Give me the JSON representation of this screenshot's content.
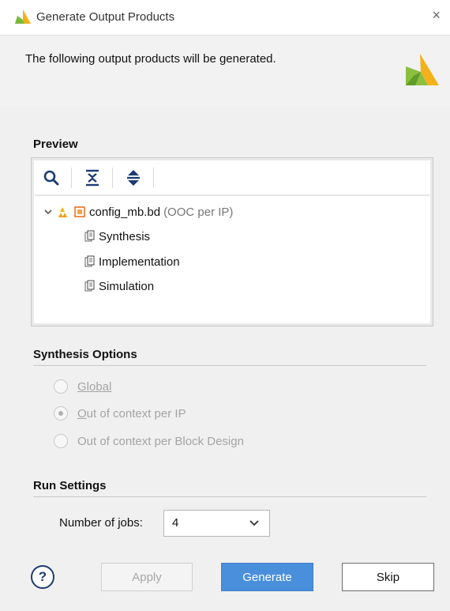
{
  "window": {
    "title": "Generate Output Products",
    "close_glyph": "×"
  },
  "header": {
    "intro_text": "The following output products will be generated."
  },
  "preview": {
    "section_label": "Preview",
    "toolbar": [
      "search-icon",
      "collapse-all-icon",
      "expand-all-icon"
    ],
    "tree": {
      "root": {
        "label": "config_mb.bd",
        "suffix": "(OOC per IP)"
      },
      "children": [
        "Synthesis",
        "Implementation",
        "Simulation"
      ]
    }
  },
  "synthesis_options": {
    "section_label": "Synthesis Options",
    "options": [
      {
        "label": "Global",
        "selected": false
      },
      {
        "label": "Out of context per IP",
        "selected": true
      },
      {
        "label": "Out of context per Block Design",
        "selected": false
      }
    ]
  },
  "run_settings": {
    "section_label": "Run Settings",
    "jobs_label": "Number of jobs:",
    "jobs_value": "4"
  },
  "buttons": {
    "help": "?",
    "apply": "Apply",
    "generate": "Generate",
    "skip": "Skip"
  },
  "colors": {
    "accent": "#4a8fdb",
    "logo_yellow": "#f3b11b",
    "logo_green": "#79b83a"
  }
}
